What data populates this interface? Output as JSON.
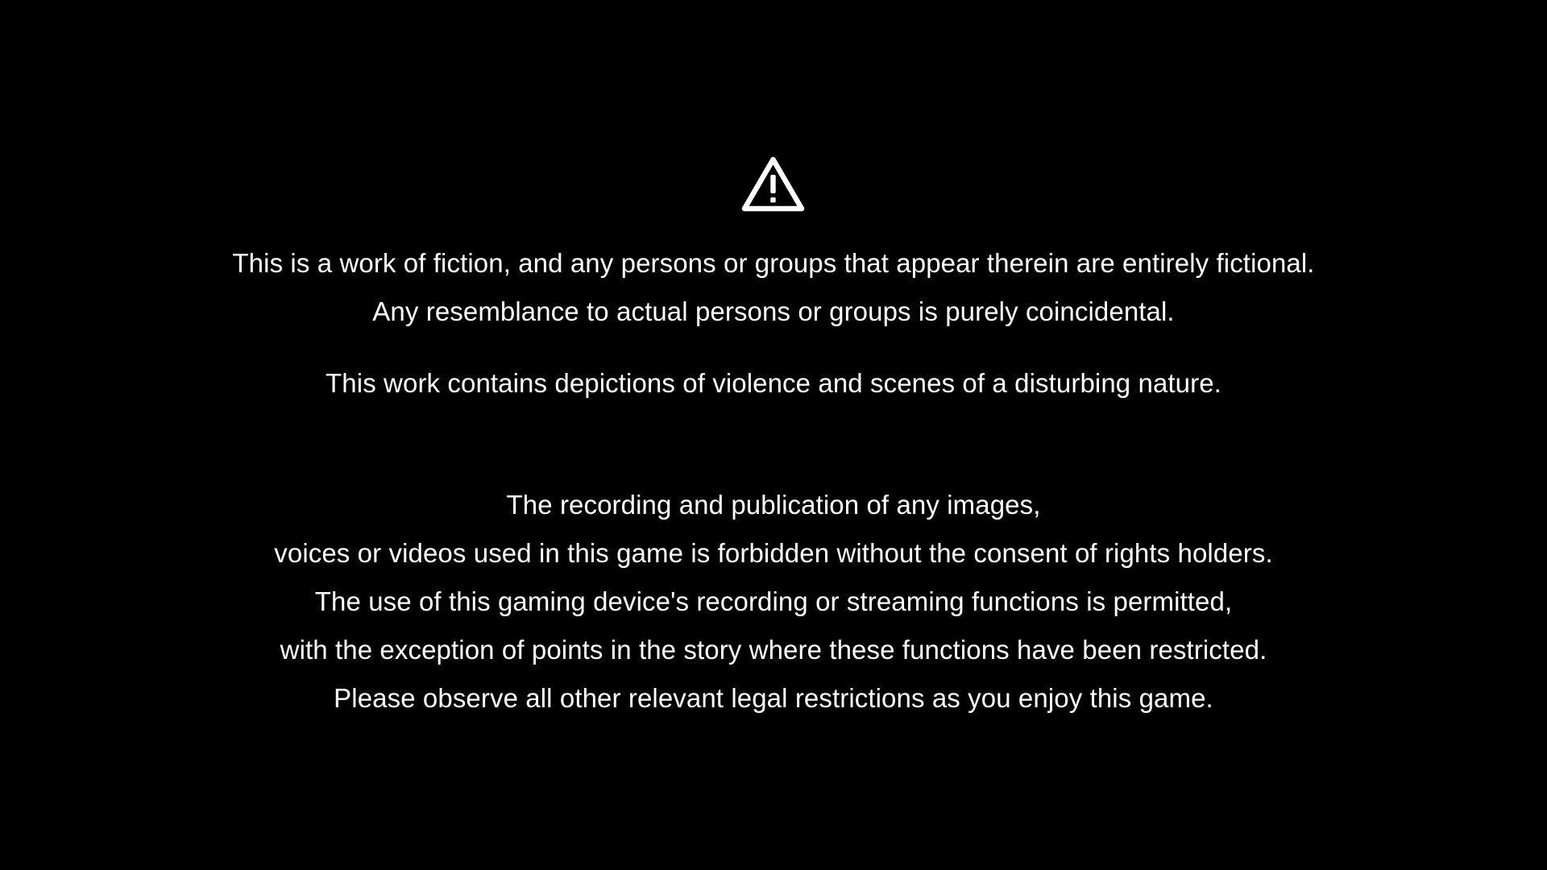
{
  "icon": "warning-triangle-icon",
  "colors": {
    "background": "#000000",
    "text": "#ffffff"
  },
  "fiction_notice": {
    "line1": "This is a work of fiction, and any persons or groups that appear therein are entirely fictional.",
    "line2": "Any resemblance to actual persons or groups is purely coincidental."
  },
  "content_notice": {
    "line1": "This work contains depictions of violence and scenes of a disturbing nature."
  },
  "recording_notice": {
    "line1": "The recording and publication of any images,",
    "line2": "voices or videos used in this game is forbidden without the consent of rights holders.",
    "line3": "The use of this gaming device's recording or streaming functions is permitted,",
    "line4": "with the exception of points in the story where these functions have been restricted.",
    "line5": "Please observe all other relevant legal restrictions as you enjoy this game."
  }
}
